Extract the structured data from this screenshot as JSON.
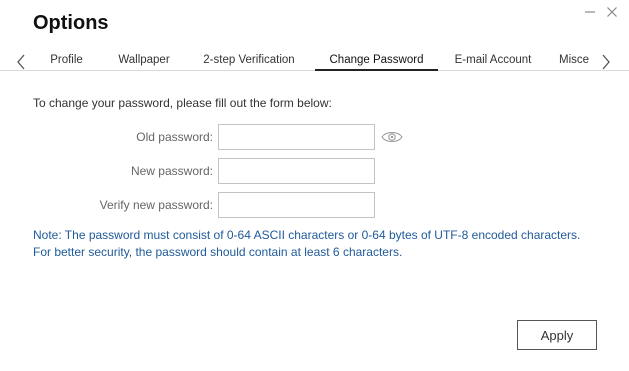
{
  "window": {
    "title": "Options",
    "minimize_icon": "minimize-icon",
    "close_icon": "close-icon"
  },
  "tabs": {
    "prev_icon": "chevron-left-icon",
    "next_icon": "chevron-right-icon",
    "items": [
      {
        "label": "Profile"
      },
      {
        "label": "Wallpaper"
      },
      {
        "label": "2-step Verification"
      },
      {
        "label": "Change Password",
        "active": true
      },
      {
        "label": "E-mail Account"
      },
      {
        "label": "Misce"
      }
    ]
  },
  "form": {
    "intro": "To change your password, please fill out the form below:",
    "old_password": {
      "label": "Old password:",
      "value": ""
    },
    "new_password": {
      "label": "New password:",
      "value": ""
    },
    "verify_password": {
      "label": "Verify new password:",
      "value": ""
    },
    "show_password_icon": "eye-icon"
  },
  "note": {
    "label": "Note",
    "line1": ": The password must consist of 0-64 ASCII characters or 0-64 bytes of UTF-8 encoded characters.",
    "line2": "For better security, the password should contain at least 6 characters."
  },
  "actions": {
    "apply_label": "Apply"
  },
  "colors": {
    "note_text": "#1f5a99",
    "active_tab_underline": "#222222"
  }
}
